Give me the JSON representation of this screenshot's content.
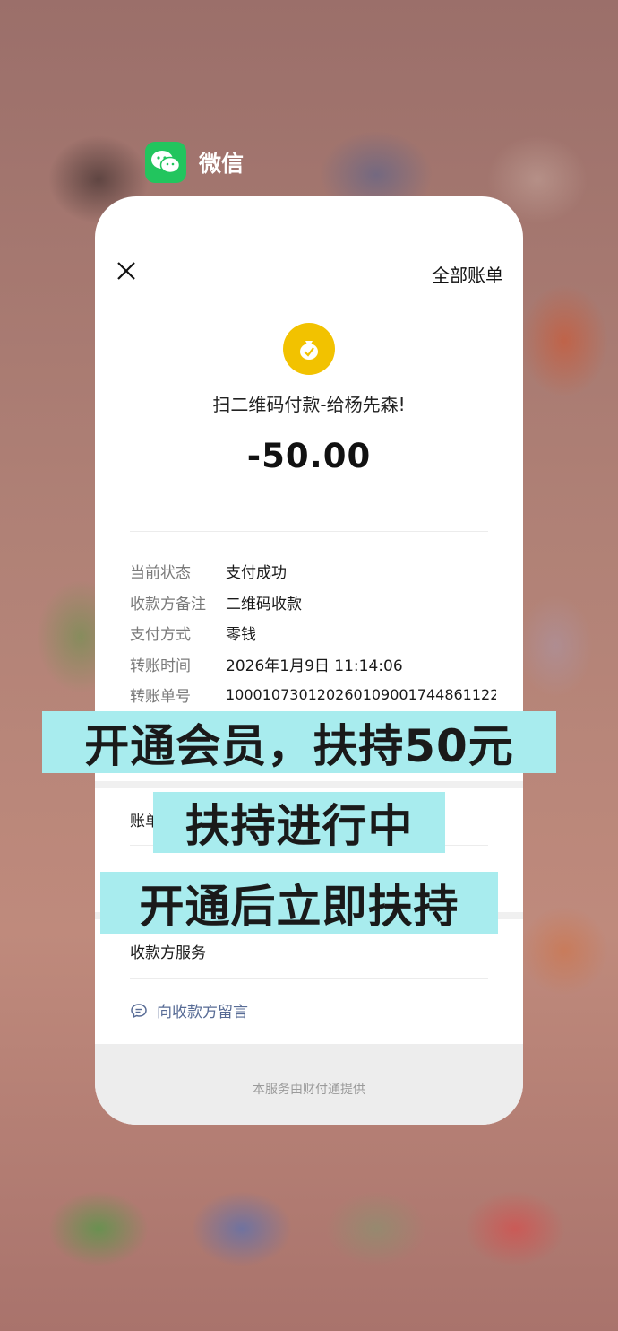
{
  "app": {
    "name": "微信",
    "icon": "wechat-icon"
  },
  "header": {
    "all_bills_label": "全部账单",
    "close_icon": "close-icon"
  },
  "transaction": {
    "merchant_icon": "money-bag-icon",
    "title": "扫二维码付款-给杨先森!",
    "amount": "-50.00"
  },
  "details": [
    {
      "label": "当前状态",
      "value": "支付成功"
    },
    {
      "label": "收款方备注",
      "value": "二维码收款"
    },
    {
      "label": "支付方式",
      "value": "零钱"
    },
    {
      "label": "转账时间",
      "value": "2026年1月9日 11:14:06"
    },
    {
      "label": "转账单号",
      "value": "100010730120260109001744861122"
    }
  ],
  "sections": {
    "bill_service_partial": "账单",
    "merchant_service": "收款方服务",
    "message_merchant": "向收款方留言"
  },
  "footer": {
    "text": "本服务由财付通提供"
  },
  "overlay": {
    "line1": "开通会员，扶持50元",
    "line2": "扶持进行中",
    "line3": "开通后立即扶持"
  },
  "colors": {
    "banner_bg": "#a8ecee",
    "link": "#576b95",
    "wechat_green": "#22c55e",
    "coin_yellow": "#f2c200"
  }
}
